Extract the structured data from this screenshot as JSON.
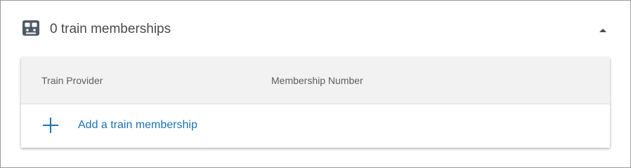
{
  "section": {
    "title": "0 train memberships",
    "icon": "train-icon",
    "collapse_icon": "chevron-up-icon"
  },
  "table": {
    "columns": [
      "Train Provider",
      "Membership Number"
    ],
    "rows": [],
    "add_action": {
      "label": "Add a train membership",
      "icon": "plus-icon"
    }
  },
  "colors": {
    "accent": "#1a73b8",
    "icon": "#4f5a66",
    "header_bg": "#f2f2f2"
  }
}
